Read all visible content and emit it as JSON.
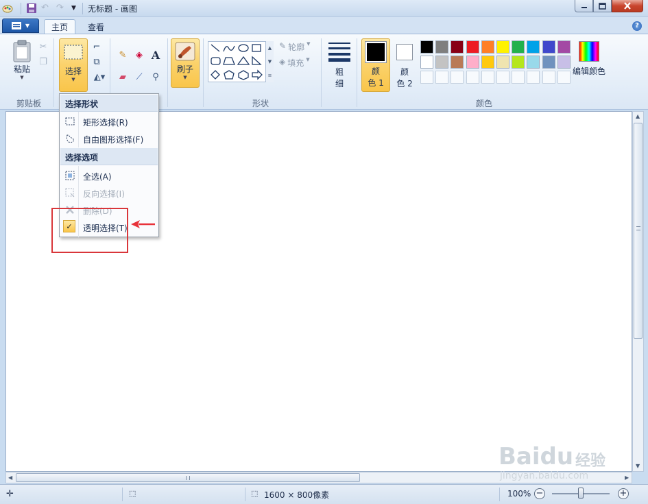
{
  "window": {
    "title": "无标题 - 画图"
  },
  "tabs": [
    {
      "label": "主页"
    },
    {
      "label": "查看"
    }
  ],
  "ribbon": {
    "clipboard": {
      "paste_label": "粘贴",
      "group_label": "剪贴板"
    },
    "image": {
      "select_label": "选择"
    },
    "tools": {},
    "brushes": {
      "label": "刷子"
    },
    "shapes": {
      "outline_label": "轮廓",
      "fill_label": "填充",
      "group_label": "形状"
    },
    "size": {
      "label_top": "粗",
      "label_bottom": "细"
    },
    "colors": {
      "color1_top": "颜",
      "color1_bottom": "色 1",
      "color2_top": "颜",
      "color2_bottom": "色 2",
      "edit_label": "编辑颜色",
      "group_label": "颜色",
      "row1": [
        "#000000",
        "#7f7f7f",
        "#880015",
        "#ed1c24",
        "#ff7f27",
        "#fff200",
        "#22b14c",
        "#00a2e8",
        "#3f48cc",
        "#a349a4"
      ],
      "row2": [
        "#ffffff",
        "#c3c3c3",
        "#b97a57",
        "#ffaec9",
        "#ffc90e",
        "#efe4b0",
        "#b5e61d",
        "#99d9ea",
        "#7092be",
        "#c8bfe7"
      ]
    }
  },
  "select_menu": {
    "header_shapes": "选择形状",
    "rect_select": "矩形选择(R)",
    "free_select": "自由图形选择(F)",
    "header_options": "选择选项",
    "select_all": "全选(A)",
    "invert_select": "反向选择(I)",
    "delete": "删除(D)",
    "transparent_select": "透明选择(T)"
  },
  "status": {
    "size_text": "1600 × 800像素",
    "zoom": "100%"
  },
  "watermark": {
    "logo": "Baidu",
    "cn": "经验",
    "url": "jingyan.baidu.com"
  }
}
